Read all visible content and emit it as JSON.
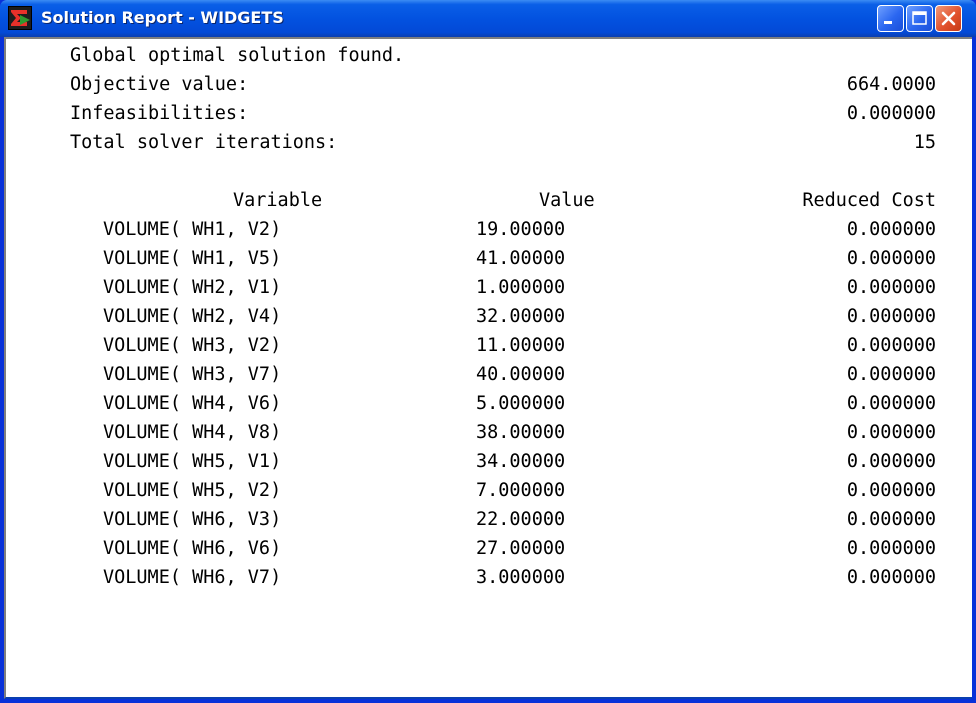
{
  "window": {
    "title": "Solution Report - WIDGETS",
    "app_icon": "sigma-icon",
    "controls": [
      "minimize-icon",
      "maximize-icon",
      "close-icon"
    ],
    "colors": {
      "titlebar": "#0352e0",
      "close_button": "#e2522e"
    }
  },
  "summary": {
    "status": "Global optimal solution found.",
    "objective_label": "Objective value:",
    "objective_value": "664.0000",
    "infeasibilities_label": "Infeasibilities:",
    "infeasibilities_value": "0.000000",
    "iterations_label": "Total solver iterations:",
    "iterations_value": "15"
  },
  "table": {
    "headers": {
      "variable": "Variable",
      "value": "Value",
      "reduced_cost": "Reduced Cost"
    },
    "rows": [
      {
        "variable": "VOLUME( WH1, V2)",
        "value": "19.00000",
        "reduced_cost": "0.000000"
      },
      {
        "variable": "VOLUME( WH1, V5)",
        "value": "41.00000",
        "reduced_cost": "0.000000"
      },
      {
        "variable": "VOLUME( WH2, V1)",
        "value": "1.000000",
        "reduced_cost": "0.000000"
      },
      {
        "variable": "VOLUME( WH2, V4)",
        "value": "32.00000",
        "reduced_cost": "0.000000"
      },
      {
        "variable": "VOLUME( WH3, V2)",
        "value": "11.00000",
        "reduced_cost": "0.000000"
      },
      {
        "variable": "VOLUME( WH3, V7)",
        "value": "40.00000",
        "reduced_cost": "0.000000"
      },
      {
        "variable": "VOLUME( WH4, V6)",
        "value": "5.000000",
        "reduced_cost": "0.000000"
      },
      {
        "variable": "VOLUME( WH4, V8)",
        "value": "38.00000",
        "reduced_cost": "0.000000"
      },
      {
        "variable": "VOLUME( WH5, V1)",
        "value": "34.00000",
        "reduced_cost": "0.000000"
      },
      {
        "variable": "VOLUME( WH5, V2)",
        "value": "7.000000",
        "reduced_cost": "0.000000"
      },
      {
        "variable": "VOLUME( WH6, V3)",
        "value": "22.00000",
        "reduced_cost": "0.000000"
      },
      {
        "variable": "VOLUME( WH6, V6)",
        "value": "27.00000",
        "reduced_cost": "0.000000"
      },
      {
        "variable": "VOLUME( WH6, V7)",
        "value": "3.000000",
        "reduced_cost": "0.000000"
      }
    ]
  }
}
